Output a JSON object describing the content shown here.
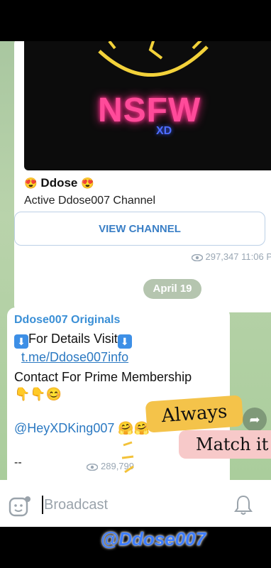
{
  "promo": {
    "neon_title": "NSFW",
    "neon_sub": "XD",
    "channel_name": "Ddose",
    "channel_desc": "Active Ddose007 Channel",
    "view_button": "VIEW CHANNEL",
    "views": "297,347",
    "time": "11:06 P"
  },
  "date_separator": "April 19",
  "message": {
    "sender": "Ddose007 Originals",
    "line1_text": "For Details Visit",
    "link": "t.me/Ddose007info",
    "line3": "Contact For Prime Membership",
    "emojis": "👇👇😊",
    "mention": "@HeyXDKing007",
    "mention_emojis": "🤗🤗",
    "dashes": "--",
    "views": "289,799"
  },
  "overlay": {
    "always": "Always",
    "match": "Match it",
    "watermark": "@Ddose007"
  },
  "input": {
    "placeholder": "Broadcast"
  },
  "icons": [
    "eye-icon",
    "sticker-icon",
    "bell-icon",
    "share-icon",
    "down-arrow-icon"
  ]
}
